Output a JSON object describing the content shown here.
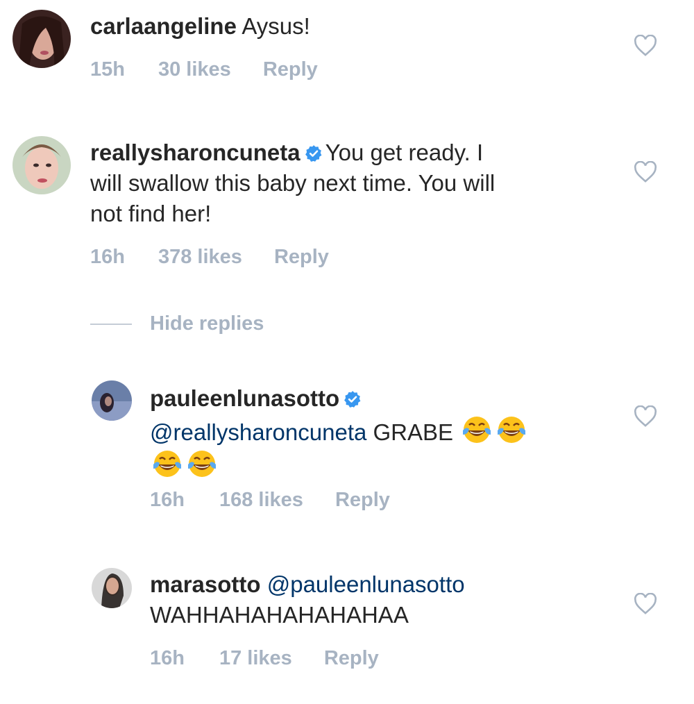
{
  "comments": [
    {
      "username": "carlaangeline",
      "text": "Aysus!",
      "time": "15h",
      "likes": "30 likes",
      "reply": "Reply"
    },
    {
      "username": "reallysharoncuneta",
      "verified": true,
      "text_line1": "You get ready. I",
      "text_line2": "will swallow this baby next time. You will",
      "text_line3": "not find her!",
      "time": "16h",
      "likes": "378 likes",
      "reply": "Reply"
    }
  ],
  "hide_replies": "Hide replies",
  "replies": [
    {
      "username": "pauleenlunasotto",
      "verified": true,
      "mention": "@reallysharoncuneta",
      "text": "GRABE",
      "emoji_name": "face-with-tears-of-joy",
      "time": "16h",
      "likes": "168 likes",
      "reply": "Reply"
    },
    {
      "username": "marasotto",
      "mention": "@pauleenlunasotto",
      "text": "WAHHAHAHAHAHAHAA",
      "time": "16h",
      "likes": "17 likes",
      "reply": "Reply"
    }
  ],
  "colors": {
    "username": "#262626",
    "mention": "#003569",
    "meta": "#a7b3c2",
    "verified": "#3897f0"
  }
}
